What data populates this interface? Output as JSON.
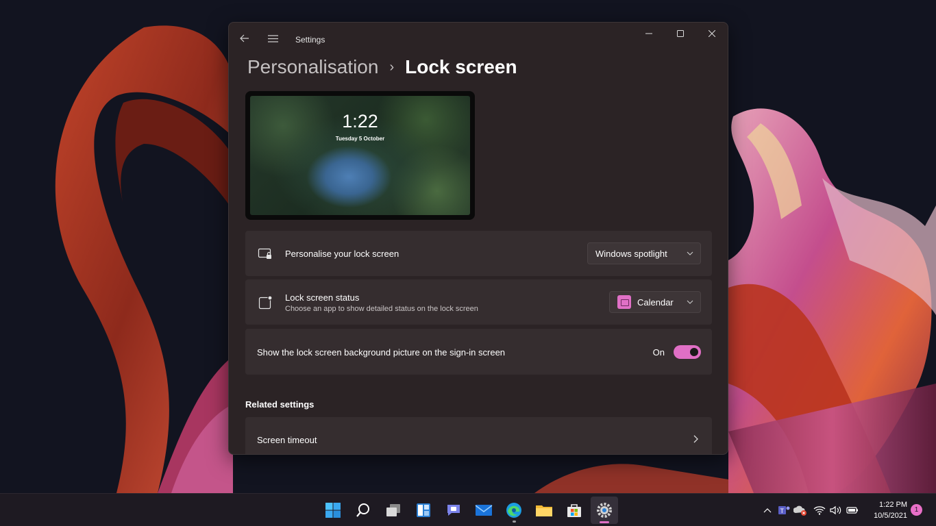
{
  "window": {
    "title": "Settings"
  },
  "breadcrumb": {
    "parent": "Personalisation",
    "separator": "›",
    "current": "Lock screen"
  },
  "preview": {
    "time": "1:22",
    "date": "Tuesday 5 October"
  },
  "settings": {
    "personalise": {
      "label": "Personalise your lock screen",
      "value": "Windows spotlight",
      "icon": "lock-screen-monitor-icon"
    },
    "status": {
      "label": "Lock screen status",
      "description": "Choose an app to show detailed status on the lock screen",
      "value": "Calendar",
      "icon": "app-status-icon"
    },
    "signin": {
      "label": "Show the lock screen background picture on the sign-in screen",
      "state_label": "On",
      "on": true
    }
  },
  "related": {
    "heading": "Related settings",
    "items": [
      {
        "label": "Screen timeout"
      }
    ]
  },
  "taskbar": {
    "apps": [
      "start",
      "search",
      "task-view",
      "widgets",
      "chat",
      "mail",
      "edge",
      "file-explorer",
      "store",
      "settings"
    ],
    "clock_time": "1:22 PM",
    "clock_date": "10/5/2021",
    "notification_count": "1"
  },
  "colors": {
    "accent": "#e06fc5",
    "window_bg": "#2b2325",
    "card_bg": "#352d2f",
    "taskbar_bg": "#1e1a22"
  }
}
